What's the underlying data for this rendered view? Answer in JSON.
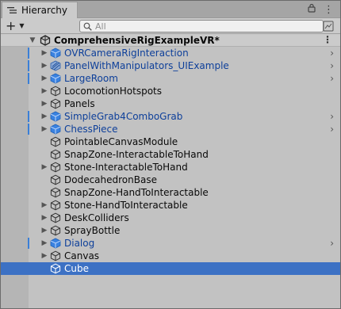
{
  "window": {
    "tab_title": "Hierarchy"
  },
  "toolbar": {
    "add_label": "+",
    "add_caret": "▼",
    "search_placeholder": "All"
  },
  "tab_tools": {
    "lock": "🔒",
    "menu": "⋮"
  },
  "scene": {
    "name": "ComprehensiveRigExampleVR*",
    "menu": "⋮"
  },
  "items": [
    {
      "label": "OVRCameraRigInteraction",
      "prefab": true,
      "foldout": "▶",
      "chevron": "›",
      "icon": "prefab-cube-icon"
    },
    {
      "label": "PanelWithManipulators_UIExample",
      "prefab": true,
      "foldout": "▶",
      "chevron": "›",
      "icon": "prefab-variant-icon"
    },
    {
      "label": "LargeRoom",
      "prefab": true,
      "foldout": "▶",
      "chevron": "›",
      "icon": "prefab-cube-icon"
    },
    {
      "label": "LocomotionHotspots",
      "prefab": false,
      "foldout": "▶",
      "chevron": "",
      "icon": "gameobject-cube-icon"
    },
    {
      "label": "Panels",
      "prefab": false,
      "foldout": "▶",
      "chevron": "",
      "icon": "gameobject-cube-icon"
    },
    {
      "label": "SimpleGrab4ComboGrab",
      "prefab": true,
      "foldout": "▶",
      "chevron": "›",
      "icon": "prefab-cube-icon"
    },
    {
      "label": "ChessPiece",
      "prefab": true,
      "foldout": "▶",
      "chevron": "›",
      "icon": "prefab-cube-icon"
    },
    {
      "label": "PointableCanvasModule",
      "prefab": false,
      "foldout": "",
      "chevron": "",
      "icon": "gameobject-cube-icon"
    },
    {
      "label": "SnapZone-InteractableToHand",
      "prefab": false,
      "foldout": "",
      "chevron": "",
      "icon": "gameobject-cube-icon"
    },
    {
      "label": "Stone-InteractableToHand",
      "prefab": false,
      "foldout": "▶",
      "chevron": "",
      "icon": "gameobject-cube-icon"
    },
    {
      "label": "DodecahedronBase",
      "prefab": false,
      "foldout": "",
      "chevron": "",
      "icon": "gameobject-cube-icon"
    },
    {
      "label": "SnapZone-HandToInteractable",
      "prefab": false,
      "foldout": "",
      "chevron": "",
      "icon": "gameobject-cube-icon"
    },
    {
      "label": "Stone-HandToInteractable",
      "prefab": false,
      "foldout": "▶",
      "chevron": "",
      "icon": "gameobject-cube-icon"
    },
    {
      "label": "DeskColliders",
      "prefab": false,
      "foldout": "▶",
      "chevron": "",
      "icon": "gameobject-cube-icon"
    },
    {
      "label": "SprayBottle",
      "prefab": false,
      "foldout": "▶",
      "chevron": "",
      "icon": "gameobject-cube-icon"
    },
    {
      "label": "Dialog",
      "prefab": true,
      "foldout": "▶",
      "chevron": "›",
      "icon": "prefab-cube-icon"
    },
    {
      "label": "Canvas",
      "prefab": false,
      "foldout": "▶",
      "chevron": "",
      "icon": "gameobject-cube-icon"
    },
    {
      "label": "Cube",
      "prefab": false,
      "foldout": "",
      "chevron": "",
      "icon": "gameobject-cube-icon",
      "selected": true
    }
  ],
  "colors": {
    "prefab_text": "#0d3f9a",
    "selection": "#3c71c4",
    "marker": "#3a7fd7"
  }
}
